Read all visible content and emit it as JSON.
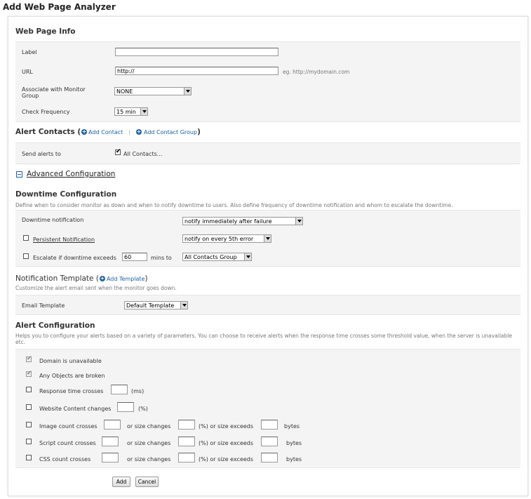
{
  "page_title": "Add Web Page Analyzer",
  "web_page_info": {
    "title": "Web Page Info",
    "label_label": "Label",
    "label_value": "",
    "url_label": "URL",
    "url_value": "http://",
    "url_hint": "eg. http://mydomain.com",
    "monitor_group_label": "Associate with Monitor Group",
    "monitor_group_value": "NONE",
    "check_frequency_label": "Check Frequency",
    "check_frequency_value": "15 min"
  },
  "alert_contacts": {
    "title": "Alert Contacts (",
    "title_close": ")",
    "add_contact": "Add Contact",
    "separator": "|",
    "add_contact_group": "Add Contact Group",
    "send_alerts_label": "Send alerts to",
    "all_contacts": "All Contacts..."
  },
  "advanced": {
    "label": "Advanced Configuration"
  },
  "downtime": {
    "title": "Downtime Configuration",
    "desc": "Define when to consider monitor as down and when to notify downtime to users. Also define frequency of downtime notification and whom to escalate the downtime.",
    "notification_label": "Downtime notification",
    "notification_value": "notify immediately after failure",
    "persistent_label": "Persistent Notification",
    "persistent_value": "notify on every 5th error",
    "escalate_label": "Escalate if downtime exceeds",
    "escalate_minutes": "60",
    "escalate_unit": "mins to",
    "escalate_group": "All Contacts Group"
  },
  "notification_template": {
    "title": "Notification Template (",
    "title_close": ")",
    "add_template": "Add Template",
    "desc": "Customize the alert email sent when the monitor goes down.",
    "email_template_label": "Email Template",
    "email_template_value": "Default Template"
  },
  "alert_config": {
    "title": "Alert Configuration",
    "desc": "Helps you to configure your alerts based on a variety of parameters. You can choose to receive alerts when the response time crosses some threshold value, when the server is unavailable etc.",
    "domain_unavailable": "Domain is unavailable",
    "objects_broken": "Any Objects are broken",
    "response_time": "Response time crosses",
    "response_unit": "(ms)",
    "content_changes": "Website Content changes",
    "content_unit": "(%)",
    "image_count": "Image count crosses",
    "script_count": "Script count crosses",
    "css_count": "CSS count crosses",
    "or_size_changes": "or size changes",
    "or_size_exceeds": "(%) or size exceeds",
    "bytes": "bytes"
  },
  "buttons": {
    "add": "Add",
    "cancel": "Cancel"
  },
  "colors": {
    "link": "#1c5fa5",
    "box_bg": "#f4f4f4"
  }
}
